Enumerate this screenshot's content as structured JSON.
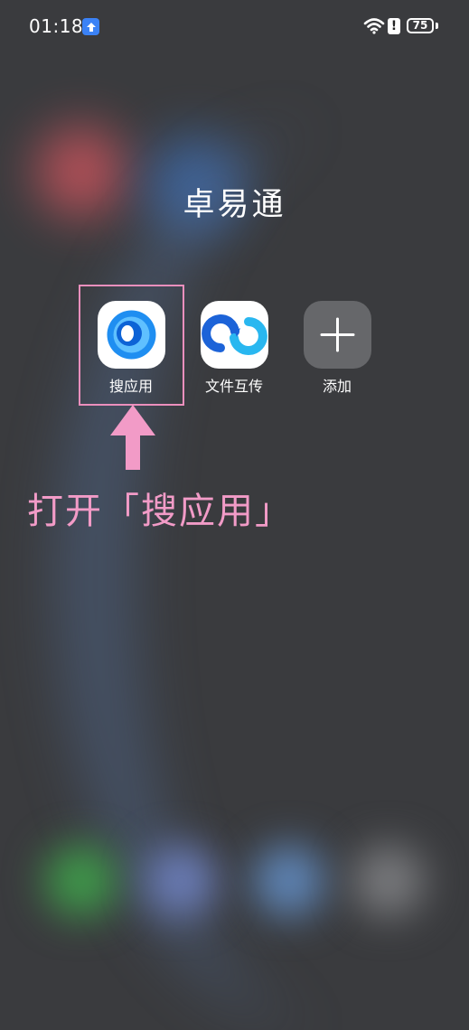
{
  "status_bar": {
    "time": "01:18",
    "battery_level": "75",
    "notification_icon": "upload-arrow-icon",
    "wifi_icon": "wifi-icon",
    "alert_icon": "alert-icon"
  },
  "folder": {
    "title": "卓易通",
    "apps": [
      {
        "label": "搜应用",
        "icon": "search-app-icon"
      },
      {
        "label": "文件互传",
        "icon": "file-transfer-icon"
      },
      {
        "label": "添加",
        "icon": "plus-icon"
      }
    ]
  },
  "annotation": {
    "text": "打开「搜应用」",
    "color": "#f29bc7",
    "box_color": "#ec8fbd"
  },
  "colors": {
    "notification_badge": "#3b82f6",
    "search_app_blue": "#1f8ef1",
    "transfer_blue": "#1c63d8"
  }
}
